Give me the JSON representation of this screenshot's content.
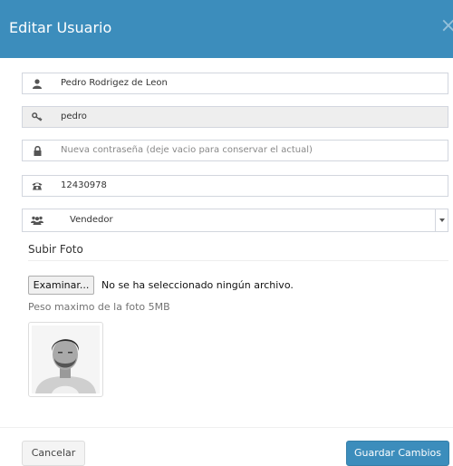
{
  "modal": {
    "title": "Editar Usuario",
    "close_glyph": "×"
  },
  "form": {
    "name": {
      "value": "Pedro Rodrigez de Leon",
      "icon": "user-icon"
    },
    "username": {
      "value": "pedro",
      "icon": "key-icon",
      "readonly": true
    },
    "password": {
      "placeholder": "Nueva contraseña (deje vacio para conservar el actual)",
      "icon": "lock-icon"
    },
    "phone": {
      "value": "12430978",
      "icon": "phone-icon"
    },
    "role": {
      "selected": "Vendedor",
      "icon": "users-icon"
    }
  },
  "photo": {
    "section_title": "Subir Foto",
    "browse_label": "Examinar...",
    "no_file_text": "No se ha seleccionado ningún archivo.",
    "help_text": "Peso maximo de la foto 5MB"
  },
  "footer": {
    "cancel_label": "Cancelar",
    "save_label": "Guardar Cambios"
  },
  "colors": {
    "header_bg": "#3c8dbc",
    "primary_button": "#3c8dbc",
    "input_border": "#d2d6de",
    "readonly_bg": "#eeeeee"
  }
}
